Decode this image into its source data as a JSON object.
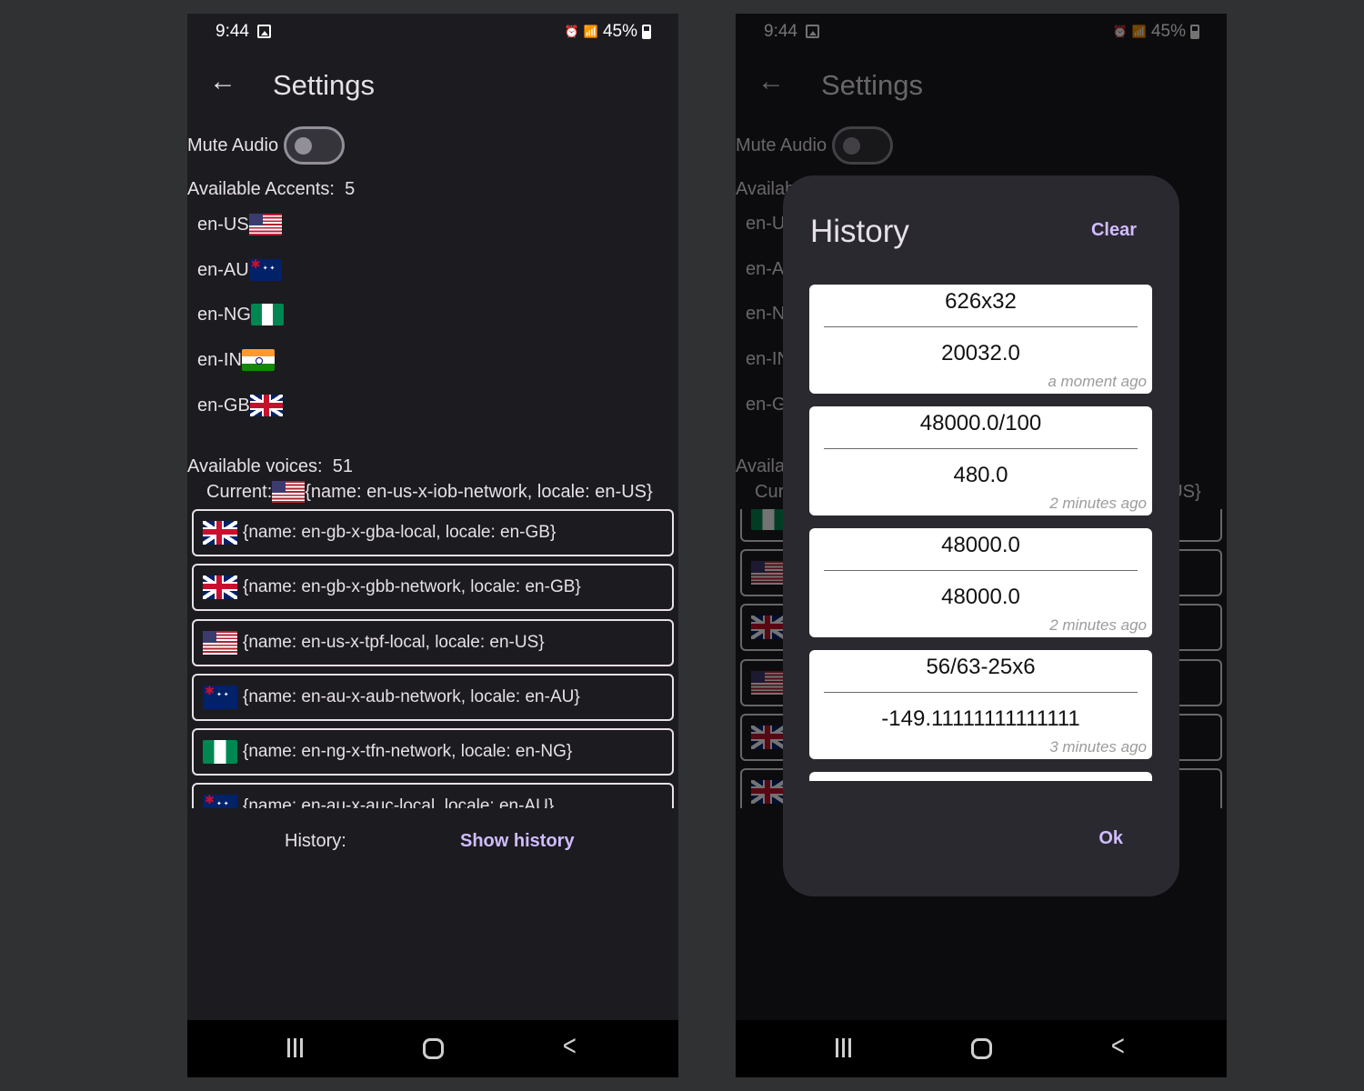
{
  "status": {
    "time": "9:44",
    "battery": "45%"
  },
  "appbar": {
    "title": "Settings"
  },
  "mute": {
    "label": "Mute Audio",
    "enabled": false
  },
  "accents": {
    "label": "Available Accents:",
    "count": "5",
    "items": [
      {
        "code": "en-US",
        "flag": "us"
      },
      {
        "code": "en-AU",
        "flag": "au"
      },
      {
        "code": "en-NG",
        "flag": "ng"
      },
      {
        "code": "en-IN",
        "flag": "in"
      },
      {
        "code": "en-GB",
        "flag": "gb"
      }
    ]
  },
  "voices": {
    "label": "Available voices:",
    "count": "51",
    "current_label": "Current:",
    "current_value": "{name: en-us-x-iob-network, locale: en-US}",
    "items": [
      {
        "flag": "gb",
        "text": "{name: en-gb-x-gba-local, locale: en-GB}"
      },
      {
        "flag": "gb",
        "text": "{name: en-gb-x-gbb-network, locale: en-GB}"
      },
      {
        "flag": "us",
        "text": "{name: en-us-x-tpf-local, locale: en-US}"
      },
      {
        "flag": "au",
        "text": "{name: en-au-x-aub-network, locale: en-AU}"
      },
      {
        "flag": "ng",
        "text": "{name: en-ng-x-tfn-network, locale: en-NG}"
      },
      {
        "flag": "au",
        "text": "{name: en-au-x-auc-local, locale: en-AU}"
      }
    ]
  },
  "history_row": {
    "label": "History:",
    "button": "Show history"
  },
  "right_screen": {
    "voice_flags": [
      "ng",
      "us",
      "gb",
      "us",
      "gb",
      "gb"
    ]
  },
  "dialog": {
    "title": "History",
    "clear": "Clear",
    "ok": "Ok",
    "entries": [
      {
        "expression": "626x32",
        "result": "20032.0",
        "time": "a moment ago"
      },
      {
        "expression": "48000.0/100",
        "result": "480.0",
        "time": "2 minutes ago"
      },
      {
        "expression": "48000.0",
        "result": "48000.0",
        "time": "2 minutes ago"
      },
      {
        "expression": "56/63-25x6",
        "result": "-149.11111111111111",
        "time": "3 minutes ago"
      }
    ]
  },
  "colors": {
    "accent": "#d0bcff",
    "background": "#1c1b20",
    "dialog": "#2b2930",
    "card": "#ffffff"
  }
}
